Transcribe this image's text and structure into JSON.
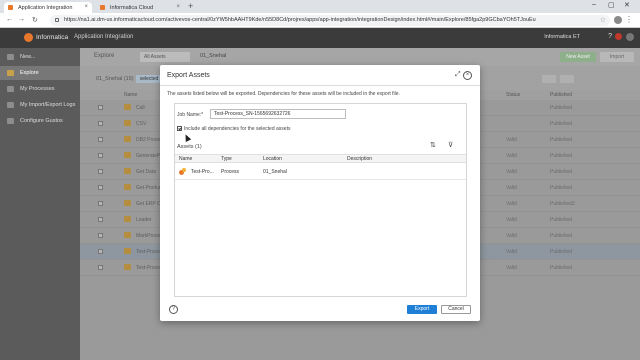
{
  "browser": {
    "tabs": [
      {
        "label": "Application Integration",
        "favicon_color": "#e8782c"
      },
      {
        "label": "Informatica Cloud",
        "favicon_color": "#e8782c"
      }
    ],
    "url": "https://na1.ai.dm-us.informaticacloud.com/activevos-central/0zYW5hbAAHT9Kde/n55D8Cd/projres/apps/app-integration/integrationDesign/index.html#/main/Explore/85fga2p9GCbaYOh5TJouEu"
  },
  "app": {
    "brand": "Informatica",
    "module": "Application Integration",
    "user": "Informatica ET"
  },
  "sidebar": {
    "items": [
      {
        "label": "New..."
      },
      {
        "label": "Explore"
      },
      {
        "label": "My Processes"
      },
      {
        "label": "My Import/Export Logs"
      },
      {
        "label": "Configure Gustos"
      }
    ]
  },
  "workspace": {
    "explore_label": "Explore",
    "filter_label": "All Assets",
    "crumb": "01_Snehal",
    "title": "01_Snehal (15)",
    "tag": "selected",
    "new_button": "New Asset",
    "import_button": "Import",
    "headers": {
      "name": "Name",
      "status": "Status",
      "published": "Published"
    },
    "rows": [
      {
        "name": "Call",
        "status": "",
        "published": "Published"
      },
      {
        "name": "CSV",
        "status": "",
        "published": "Published"
      },
      {
        "name": "DB2 Process",
        "status": "Valid",
        "published": "Published"
      },
      {
        "name": "GenerateProcess",
        "status": "Valid",
        "published": "Published"
      },
      {
        "name": "Get Data",
        "status": "Valid",
        "published": "Published"
      },
      {
        "name": "Get Product",
        "status": "Valid",
        "published": "Published"
      },
      {
        "name": "Get ERP Order",
        "status": "Valid",
        "published": "Published2"
      },
      {
        "name": "Loader",
        "status": "Valid",
        "published": "Published"
      },
      {
        "name": "MarkProcess",
        "status": "Valid",
        "published": "Published"
      },
      {
        "name": "Test-Process_SN",
        "status": "Valid",
        "published": "Published",
        "selected": true
      },
      {
        "name": "Test-Process_SN2",
        "status": "Valid",
        "published": "Published"
      }
    ]
  },
  "dialog": {
    "title": "Export Assets",
    "note": "The assets listed below will be exported. Dependencies for these assets will be included in the export file.",
    "job_label": "Job Name:*",
    "job_value": "Test-Process_SN-1565692632726",
    "deps_label": "Include all dependencies for the selected assets",
    "assets_label": "Assets (1)",
    "columns": {
      "name": "Name",
      "type": "Type",
      "location": "Location",
      "description": "Description"
    },
    "asset": {
      "name": "Test-Pro...",
      "type": "Process",
      "location": "01_Snehal",
      "description": ""
    },
    "export_button": "Export",
    "cancel_button": "Cancel",
    "sort_icon": "⇅",
    "filter_icon": "⊽"
  }
}
